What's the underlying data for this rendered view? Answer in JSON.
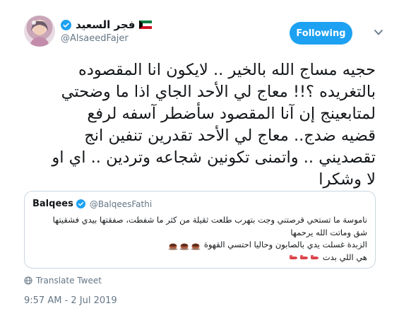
{
  "author": {
    "display_name": "فجر السعيد",
    "handle": "@AlsaeedFajer",
    "flag": "kuwait-flag-icon",
    "verified": true
  },
  "follow_button": {
    "label": "Following",
    "color": "#1da1f2"
  },
  "tweet": {
    "text": "حجيه مساج الله بالخير .. لايكون انا المقصوده\nبالتغريده ؟!! معاج لي الأحد الجاي اذا ما وضحتي\nلمتابعينج إن آنا المقصود سأضطر آسفه لرفع\nقضيه ضدج.. معاج لي الأحد تقدرين تنفين انج\nتقصديني .. واتمنى تكونين شجاعه وتردين .. اي او\nلا وشكرا"
  },
  "quote": {
    "display_name": "Balqees",
    "handle": "@BalqeesFathi",
    "verified": true,
    "lines": [
      "ناموسة ما تستحي قرصتني وجت بتهرب طلعت ثقيلة من كثر ما شفطت، صفقتها بيدي فشقيتها",
      "شق وماتت الله يرحمها",
      "الزبدة غسلت يدي بالصابون وحاليا احتسي القهوة",
      "هي اللي بدت"
    ],
    "emojis": {
      "coffee": [
        "coffee-icon",
        "coffee-icon",
        "coffee-icon"
      ],
      "pointing": [
        "pointing-hand-icon",
        "pointing-hand-icon",
        "pointing-hand-icon"
      ]
    }
  },
  "translate": {
    "label": "Translate Tweet",
    "icon": "globe-icon"
  },
  "timestamp": "9:57 AM - 2 Jul 2019",
  "colors": {
    "accent": "#1da1f2",
    "secondary_text": "#657786",
    "border": "#ccd6dd"
  }
}
